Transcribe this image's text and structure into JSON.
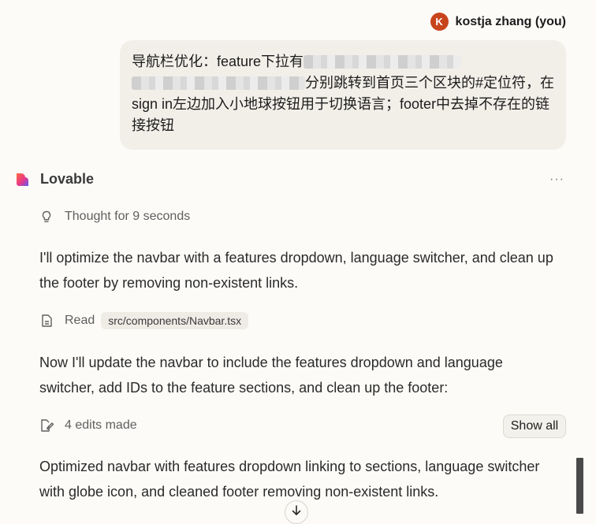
{
  "user": {
    "avatar_letter": "K",
    "name": "kostja zhang (you)",
    "message_parts": [
      "导航栏优化：feature下拉有",
      "分别跳转到首页三个区块的#定位符，在sign in左边加入小地球按钮用于切换语言；footer中去掉不存在的链接按钮"
    ]
  },
  "assistant": {
    "name": "Lovable",
    "more_label": "···",
    "thought": "Thought for 9 seconds",
    "message_1": "I'll optimize the navbar with a features dropdown, language switcher, and clean up the footer by removing non-existent links.",
    "read_label": "Read",
    "read_file": "src/components/Navbar.tsx",
    "message_2": "Now I'll update the navbar to include the features dropdown and language switcher, add IDs to the feature sections, and clean up the footer:",
    "edits_label": "4 edits made",
    "show_all_label": "Show all",
    "message_3": "Optimized navbar with features dropdown linking to sections, language switcher with globe icon, and cleaned footer removing non-existent links."
  },
  "colors": {
    "background": "#fcfbf8",
    "bubble": "#f2efe9",
    "avatar": "#c8441c"
  },
  "icons": [
    "heart-logo-icon",
    "lightbulb-icon",
    "document-icon",
    "edit-document-icon",
    "more-icon",
    "arrow-down-icon"
  ]
}
